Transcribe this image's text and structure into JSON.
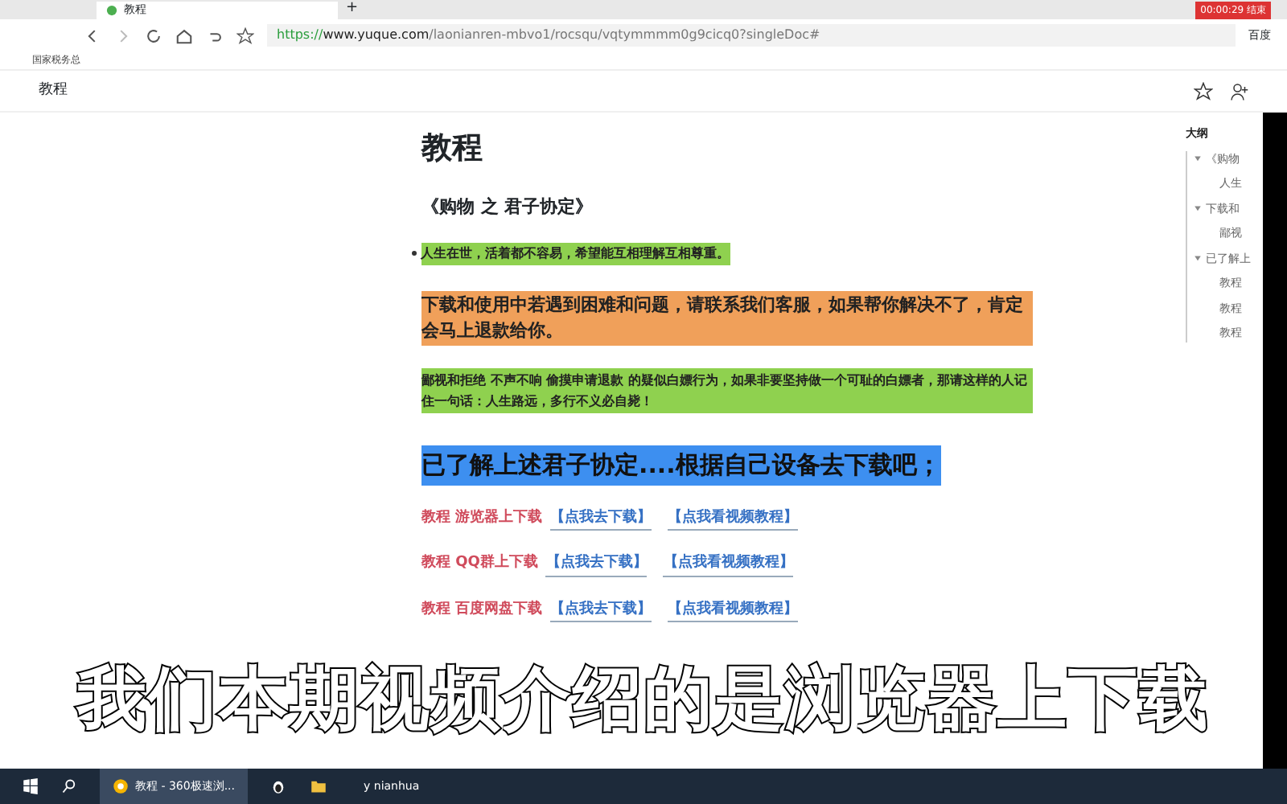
{
  "browser": {
    "tab_title": "教程",
    "new_tab": "+",
    "url_scheme": "https://",
    "url_host": "www.yuque.com",
    "url_path": "/laonianren-mbvo1/rocsqu/vqtymmmm0g9cicq0?singleDoc#",
    "bookmark": "国家税务总",
    "search_engine": "百度",
    "recording": "00:00:29 结束"
  },
  "doc_header": {
    "title": "教程"
  },
  "doc": {
    "title": "教程",
    "subtitle": "《购物 之 君子协定》",
    "blocks": [
      {
        "kind": "bullet",
        "text": "人生在世，活着都不容易，希望能互相理解互相尊重。",
        "color": "#8fd14f"
      },
      {
        "kind": "large",
        "text": "下载和使用中若遇到困难和问题，请联系我们客服，如果帮你解决不了，肯定会马上退款给你。",
        "color": "#f0a05a"
      },
      {
        "kind": "small",
        "text": "鄙视和拒绝  不声不响  偷摸申请退款  的疑似白嫖行为，如果非要坚持做一个可耻的白嫖者，那请这样的人记住一句话：人生路远，多行不义必自毙！",
        "color": "#8fd14f"
      },
      {
        "kind": "heading",
        "text": "已了解上述君子协定....根据自己设备去下载吧；",
        "color": "#3d8ff0"
      }
    ],
    "links": [
      {
        "label": "教程 游览器上下载",
        "download": "【点我去下载】",
        "video": "【点我看视频教程】"
      },
      {
        "label": "教程 QQ群上下载",
        "download": "【点我去下载】",
        "video": "【点我看视频教程】"
      },
      {
        "label": "教程 百度网盘下载",
        "download": "【点我去下载】",
        "video": "【点我看视频教程】"
      }
    ]
  },
  "outline": {
    "title": "大纲",
    "items": [
      {
        "text": "《购物",
        "children": [
          {
            "text": "人生"
          }
        ]
      },
      {
        "text": "下载和",
        "children": [
          {
            "text": "鄙视"
          }
        ]
      },
      {
        "text": "已了解上",
        "children": [
          {
            "text": "教程"
          },
          {
            "text": "教程"
          },
          {
            "text": "教程"
          }
        ]
      }
    ]
  },
  "subtitle": "我们本期视频介绍的是浏览器上下载",
  "taskbar": {
    "apps": [
      "教程 - 360极速浏...",
      "y nianhua"
    ]
  }
}
